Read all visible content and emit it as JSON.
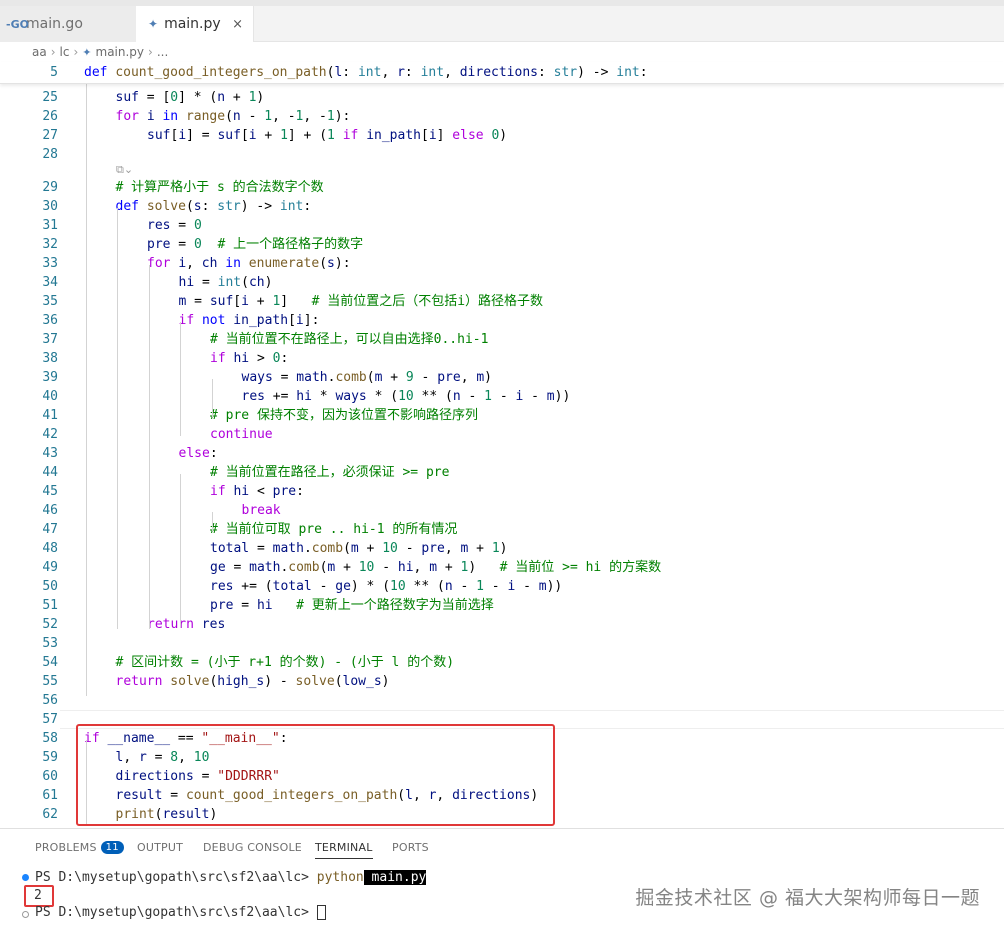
{
  "tabs": [
    {
      "label": "main.go",
      "icon": "go-file-icon"
    },
    {
      "label": "main.py",
      "icon": "python-file-icon",
      "close": "×"
    }
  ],
  "breadcrumb": {
    "parts": [
      "aa",
      "lc",
      "main.py",
      "..."
    ]
  },
  "sticky": {
    "ln": "5"
  },
  "codelens": "⧉⌄",
  "colors": {
    "keyword": "#0000ff",
    "control": "#af00db",
    "function": "#795e26",
    "type": "#267f99",
    "number": "#098658",
    "string": "#a31515",
    "comment": "#008000",
    "variable": "#001080",
    "linenum": "#237893",
    "highlight_box": "#e03838"
  },
  "lines": [
    {
      "n": "25"
    },
    {
      "n": "26"
    },
    {
      "n": "27"
    },
    {
      "n": "28"
    },
    {
      "n": "29"
    },
    {
      "n": "30"
    },
    {
      "n": "31"
    },
    {
      "n": "32"
    },
    {
      "n": "33"
    },
    {
      "n": "34"
    },
    {
      "n": "35"
    },
    {
      "n": "36"
    },
    {
      "n": "37"
    },
    {
      "n": "38"
    },
    {
      "n": "39"
    },
    {
      "n": "40"
    },
    {
      "n": "41"
    },
    {
      "n": "42"
    },
    {
      "n": "43"
    },
    {
      "n": "44"
    },
    {
      "n": "45"
    },
    {
      "n": "46"
    },
    {
      "n": "47"
    },
    {
      "n": "48"
    },
    {
      "n": "49"
    },
    {
      "n": "50"
    },
    {
      "n": "51"
    },
    {
      "n": "52"
    },
    {
      "n": "53"
    },
    {
      "n": "54"
    },
    {
      "n": "55"
    },
    {
      "n": "56"
    },
    {
      "n": "57"
    },
    {
      "n": "58"
    },
    {
      "n": "59"
    },
    {
      "n": "60"
    },
    {
      "n": "61"
    },
    {
      "n": "62"
    }
  ],
  "tokens": {
    "l5": [
      "def",
      " ",
      "count_good_integers_on_path",
      "(",
      "l",
      ": ",
      "int",
      ", ",
      "r",
      ": ",
      "int",
      ", ",
      "directions",
      ": ",
      "str",
      ") -> ",
      "int",
      ":"
    ],
    "l25": [
      "suf",
      " = [",
      "0",
      "] * (",
      "n",
      " + ",
      "1",
      ")"
    ],
    "l26": [
      "for",
      " ",
      "i",
      " ",
      "in",
      " ",
      "range",
      "(",
      "n",
      " - ",
      "1",
      ", -",
      "1",
      ", -",
      "1",
      "):"
    ],
    "l27": [
      "suf",
      "[",
      "i",
      "] = ",
      "suf",
      "[",
      "i",
      " + ",
      "1",
      "] + (",
      "1",
      " ",
      "if",
      " ",
      "in_path",
      "[",
      "i",
      "] ",
      "else",
      " ",
      "0",
      ")"
    ],
    "l29": [
      "# 计算严格小于 s 的合法数字个数"
    ],
    "l30": [
      "def",
      " ",
      "solve",
      "(",
      "s",
      ": ",
      "str",
      ") -> ",
      "int",
      ":"
    ],
    "l31": [
      "res",
      " = ",
      "0"
    ],
    "l32": [
      "pre",
      " = ",
      "0",
      "  ",
      "# 上一个路径格子的数字"
    ],
    "l33": [
      "for",
      " ",
      "i",
      ", ",
      "ch",
      " ",
      "in",
      " ",
      "enumerate",
      "(",
      "s",
      "):"
    ],
    "l34": [
      "hi",
      " = ",
      "int",
      "(",
      "ch",
      ")"
    ],
    "l35": [
      "m",
      " = ",
      "suf",
      "[",
      "i",
      " + ",
      "1",
      "]   ",
      "# 当前位置之后（不包括i）路径格子数"
    ],
    "l36": [
      "if",
      " ",
      "not",
      " ",
      "in_path",
      "[",
      "i",
      "]:"
    ],
    "l37": [
      "# 当前位置不在路径上，可以自由选择0..hi-1"
    ],
    "l38": [
      "if",
      " ",
      "hi",
      " > ",
      "0",
      ":"
    ],
    "l39": [
      "ways",
      " = ",
      "math",
      ".",
      "comb",
      "(",
      "m",
      " + ",
      "9",
      " - ",
      "pre",
      ", ",
      "m",
      ")"
    ],
    "l40": [
      "res",
      " += ",
      "hi",
      " * ",
      "ways",
      " * (",
      "10",
      " ** (",
      "n",
      " - ",
      "1",
      " - ",
      "i",
      " - ",
      "m",
      "))"
    ],
    "l41": [
      "# pre 保持不变，因为该位置不影响路径序列"
    ],
    "l42": [
      "continue"
    ],
    "l43": [
      "else",
      ":"
    ],
    "l44": [
      "# 当前位置在路径上，必须保证 >= pre"
    ],
    "l45": [
      "if",
      " ",
      "hi",
      " < ",
      "pre",
      ":"
    ],
    "l46": [
      "break"
    ],
    "l47": [
      "# 当前位可取 pre .. hi-1 的所有情况"
    ],
    "l48": [
      "total",
      " = ",
      "math",
      ".",
      "comb",
      "(",
      "m",
      " + ",
      "10",
      " - ",
      "pre",
      ", ",
      "m",
      " + ",
      "1",
      ")"
    ],
    "l49": [
      "ge",
      " = ",
      "math",
      ".",
      "comb",
      "(",
      "m",
      " + ",
      "10",
      " - ",
      "hi",
      ", ",
      "m",
      " + ",
      "1",
      ")   ",
      "# 当前位 >= hi 的方案数"
    ],
    "l50": [
      "res",
      " += (",
      "total",
      " - ",
      "ge",
      ") * (",
      "10",
      " ** (",
      "n",
      " - ",
      "1",
      " - ",
      "i",
      " - ",
      "m",
      "))"
    ],
    "l51": [
      "pre",
      " = ",
      "hi",
      "   ",
      "# 更新上一个路径数字为当前选择"
    ],
    "l52": [
      "return",
      " ",
      "res"
    ],
    "l54": [
      "# 区间计数 = (小于 r+1 的个数) - (小于 l 的个数)"
    ],
    "l55": [
      "return",
      " ",
      "solve",
      "(",
      "high_s",
      ") - ",
      "solve",
      "(",
      "low_s",
      ")"
    ],
    "l58": [
      "if",
      " ",
      "__name__",
      " == ",
      "\"__main__\"",
      ":"
    ],
    "l59": [
      "l",
      ", ",
      "r",
      " = ",
      "8",
      ", ",
      "10"
    ],
    "l60": [
      "directions",
      " = ",
      "\"DDDRRR\""
    ],
    "l61": [
      "result",
      " = ",
      "count_good_integers_on_path",
      "(",
      "l",
      ", ",
      "r",
      ", ",
      "directions",
      ")"
    ],
    "l62": [
      "print",
      "(",
      "result",
      ")"
    ]
  },
  "panel": {
    "tabs": [
      "PROBLEMS",
      "OUTPUT",
      "DEBUG CONSOLE",
      "TERMINAL",
      "PORTS"
    ],
    "problems_count": "11",
    "prompt1": "PS D:\\mysetup\\gopath\\src\\sf2\\aa\\lc> ",
    "cmd": "python",
    "arg": " main.py",
    "output": "2",
    "prompt2": "PS D:\\mysetup\\gopath\\src\\sf2\\aa\\lc> "
  },
  "watermark": "掘金技术社区 @ 福大大架构师每日一题"
}
